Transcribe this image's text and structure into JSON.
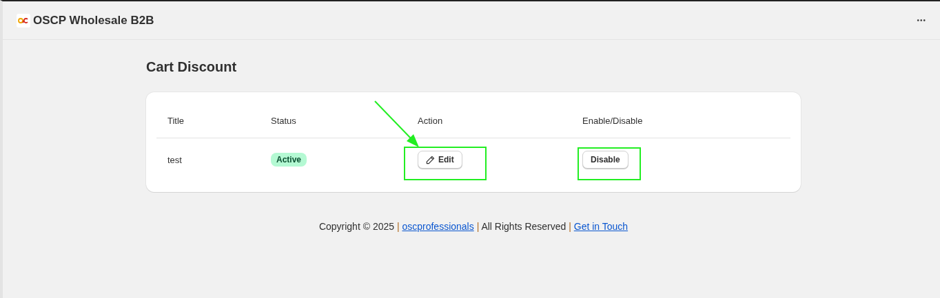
{
  "app": {
    "title": "OSCP Wholesale B2B",
    "menu_glyph": "•••"
  },
  "page": {
    "title": "Cart Discount"
  },
  "table": {
    "columns": [
      "Title",
      "Status",
      "Action",
      "Enable/Disable"
    ],
    "rows": [
      {
        "title": "test",
        "status": {
          "label": "Active",
          "color": "#b4f9d3"
        },
        "action": "Edit",
        "toggle": "Disable"
      }
    ]
  },
  "footer": [
    {
      "kind": "text",
      "text": "Copyright © 2025"
    },
    {
      "kind": "separator",
      "text": "|"
    },
    {
      "kind": "link",
      "text": "oscprofessionals"
    },
    {
      "kind": "separator",
      "text": "|"
    },
    {
      "kind": "text",
      "text": "All Rights Reserved"
    },
    {
      "kind": "separator",
      "text": "|"
    },
    {
      "kind": "link",
      "text": "Get in Touch"
    }
  ]
}
